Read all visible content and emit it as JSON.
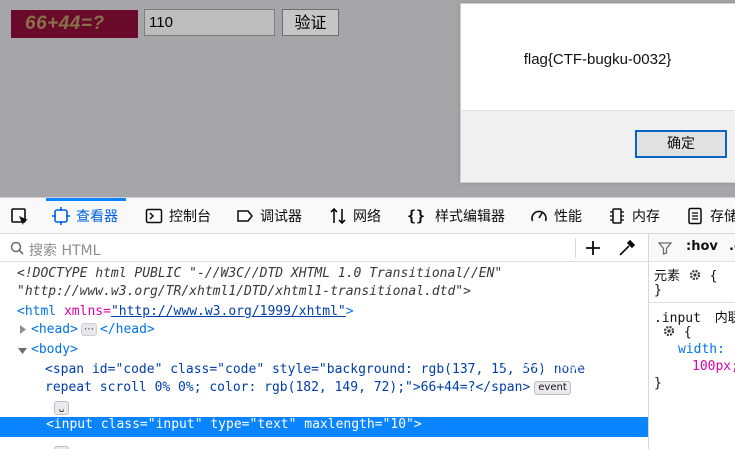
{
  "page": {
    "captcha_text": "66+44=?",
    "answer_value": "110",
    "verify_label": "验证"
  },
  "dialog": {
    "message": "flag{CTF-bugku-0032}",
    "ok_label": "确定"
  },
  "devtools": {
    "tabs": [
      {
        "label": "查看器",
        "icon": "inspector-icon"
      },
      {
        "label": "控制台",
        "icon": "console-icon"
      },
      {
        "label": "调试器",
        "icon": "debugger-icon"
      },
      {
        "label": "网络",
        "icon": "network-icon"
      },
      {
        "label": "样式编辑器",
        "icon": "style-editor-icon"
      },
      {
        "label": "性能",
        "icon": "performance-icon"
      },
      {
        "label": "内存",
        "icon": "memory-icon"
      },
      {
        "label": "存储",
        "icon": "storage-icon"
      }
    ],
    "search_placeholder": "搜索 HTML",
    "markup": {
      "doctype_1": "<!DOCTYPE html PUBLIC \"-//W3C//DTD XHTML 1.0 Transitional//EN\"",
      "doctype_2": "\"http://www.w3.org/TR/xhtml1/DTD/xhtml1-transitional.dtd\">",
      "html_open_tag": "<html",
      "html_attr": " xmlns=",
      "html_attr_val": "\"http://www.w3.org/1999/xhtml\"",
      "html_close": ">",
      "head_open": "<head>",
      "head_close": "</head>",
      "head_ellipsis": "⋯",
      "body_open": "<body>",
      "span_line_1": "<span id=\"code\" class=\"code\" style=\"background: rgb(137, 15, 56) none",
      "span_line_2": "repeat scroll 0% 0%; color: rgb(182, 149, 72);\">66+44=?</span>",
      "event_badge": "event",
      "whitespace_badge": "␣",
      "selected_line": "<input class=\"input\" type=\"text\" maxlength=\"10\">"
    },
    "watermark": "https://blog.csdn.net/NEMOAMO",
    "rules": {
      "hov": ":hov",
      "cls": ".c",
      "element_label": "元素",
      "element_brace_open": "{",
      "element_brace_close": "}",
      "selector": ".input",
      "inline_label": "内联",
      "rule_open": "{",
      "prop_name": "width:",
      "prop_value": "100px;",
      "rule_close": "}"
    }
  }
}
